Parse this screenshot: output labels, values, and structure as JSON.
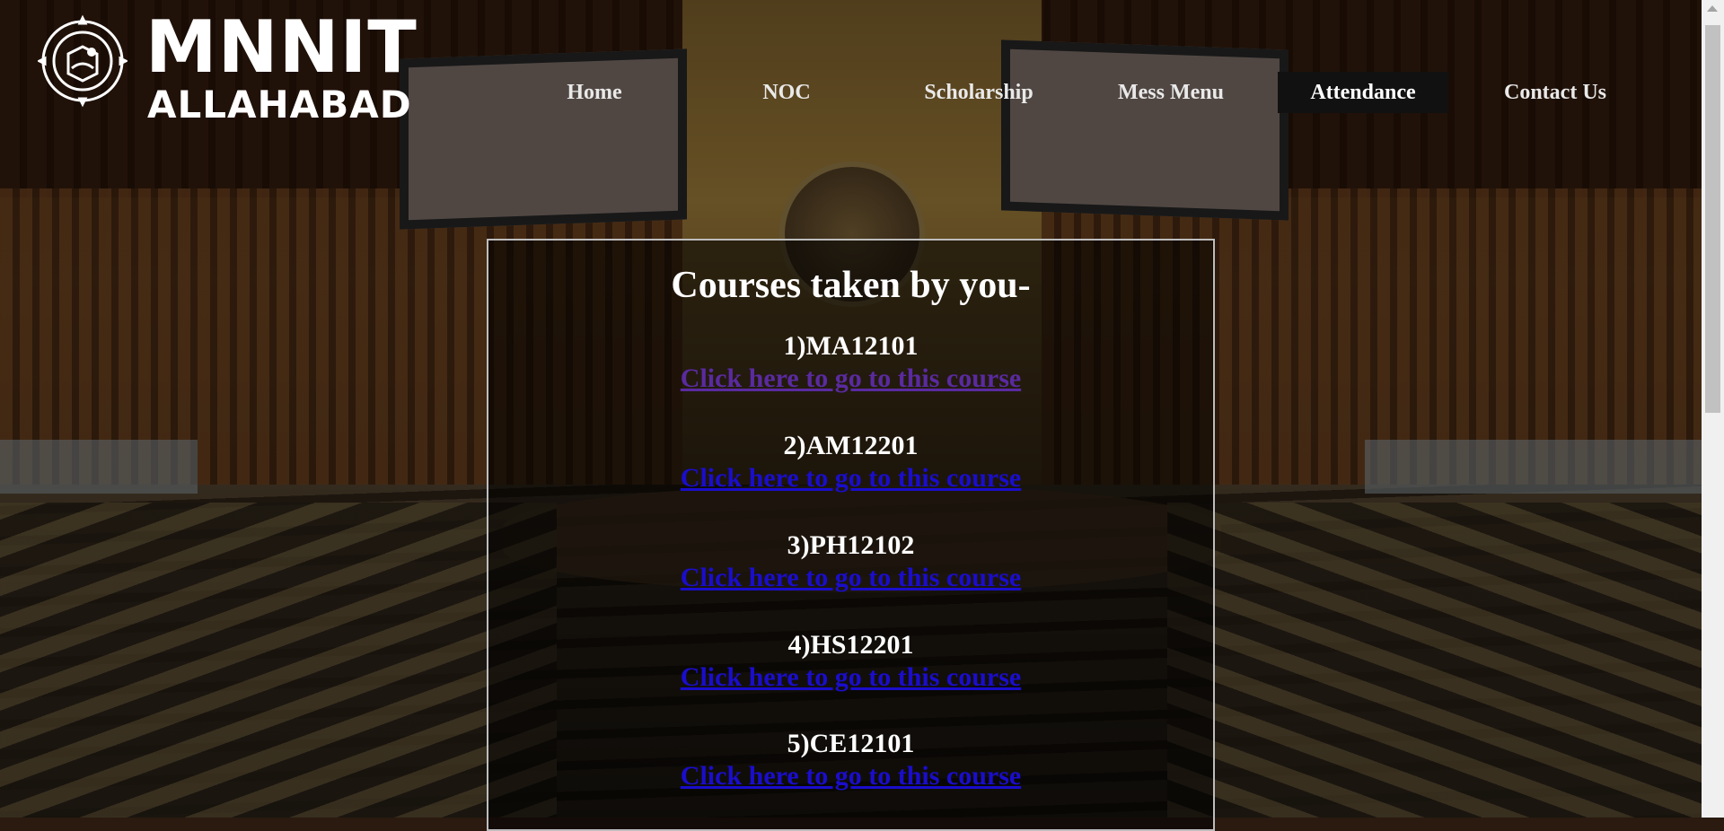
{
  "brand": {
    "line1": "MNNIT",
    "line2": "ALLAHABAD"
  },
  "nav": {
    "items": [
      {
        "label": "Home"
      },
      {
        "label": "NOC"
      },
      {
        "label": "Scholarship"
      },
      {
        "label": "Mess Menu"
      },
      {
        "label": "Attendance"
      },
      {
        "label": "Contact Us"
      }
    ],
    "active": "Attendance"
  },
  "main": {
    "heading": "Courses taken by you-",
    "courses": [
      {
        "code": "1)MA12101",
        "link": "Click here to go to this course"
      },
      {
        "code": "2)AM12201",
        "link": "Click here to go to this course"
      },
      {
        "code": "3)PH12102",
        "link": "Click here to go to this course"
      },
      {
        "code": "4)HS12201",
        "link": "Click here to go to this course"
      },
      {
        "code": "5)CE12101",
        "link": "Click here to go to this course"
      }
    ]
  },
  "colors": {
    "link": "#1a0dcc",
    "visited_link": "#5a2aa0",
    "active_nav_bg": "#111111"
  }
}
